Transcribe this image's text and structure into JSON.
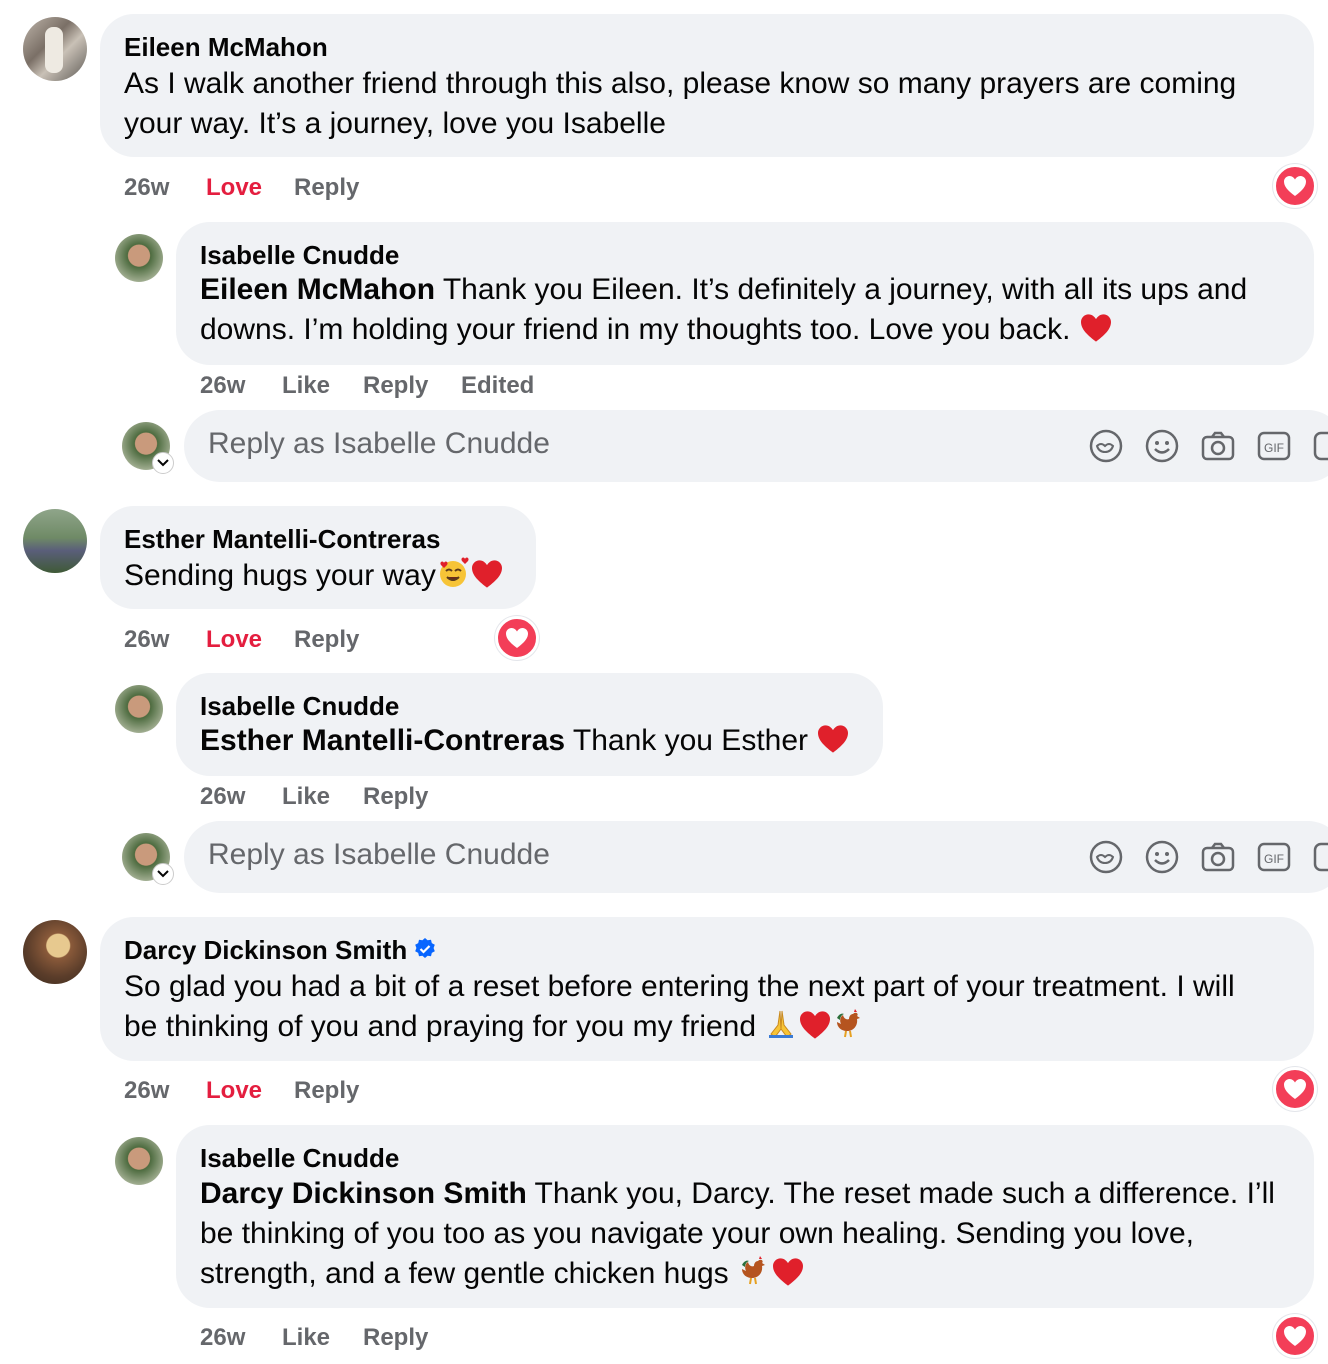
{
  "comments": [
    {
      "author": "Eileen McMahon",
      "text_line1": "As I walk another friend through this also, please know so many prayers are coming",
      "text_line2": "your way. It’s a journey, love you Isabelle",
      "time": "26w",
      "like_label": "Love",
      "reply_label": "Reply",
      "reaction": "love"
    },
    {
      "author": "Isabelle Cnudde",
      "mention": "Eileen McMahon",
      "text_line1": " Thank you Eileen. It’s definitely a journey, with all its ups and",
      "text_line2": "downs. I’m holding your friend in my thoughts too. Love you back. ",
      "time": "26w",
      "like_label": "Like",
      "reply_label": "Reply",
      "edited_label": "Edited"
    },
    {
      "author": "Esther Mantelli-Contreras",
      "text_line1": "Sending hugs your way",
      "time": "26w",
      "like_label": "Love",
      "reply_label": "Reply",
      "reaction": "love"
    },
    {
      "author": "Isabelle Cnudde",
      "mention": "Esther Mantelli-Contreras",
      "text_line1": " Thank you Esther ",
      "time": "26w",
      "like_label": "Like",
      "reply_label": "Reply"
    },
    {
      "author": "Darcy Dickinson Smith",
      "verified": true,
      "text_line1": "So glad you had a bit of a reset before entering the next part of your treatment. I will",
      "text_line2": "be thinking of you and praying for you my friend ",
      "time": "26w",
      "like_label": "Love",
      "reply_label": "Reply",
      "reaction": "love"
    },
    {
      "author": "Isabelle Cnudde",
      "mention": "Darcy Dickinson Smith",
      "text_line1": " Thank you, Darcy. The reset made such a difference. I’ll",
      "text_line2": "be thinking of you too as you navigate your own healing. Sending you love,",
      "text_line3": "strength, and a few gentle chicken hugs ",
      "time": "26w",
      "like_label": "Like",
      "reply_label": "Reply",
      "reaction": "love"
    }
  ],
  "reply_boxes": [
    {
      "placeholder": "Reply as Isabelle Cnudde"
    },
    {
      "placeholder": "Reply as Isabelle Cnudde"
    }
  ],
  "icons": {
    "reaction": "heart-icon",
    "tools": [
      "avatar-sticker-icon",
      "emoji-icon",
      "camera-icon",
      "gif-icon",
      "sticker-icon"
    ]
  },
  "colors": {
    "bubble": "#f0f2f5",
    "meta_text": "#65676b",
    "love_text": "#e41e3f",
    "love_reaction": "#f33e58",
    "verified": "#0866ff"
  }
}
